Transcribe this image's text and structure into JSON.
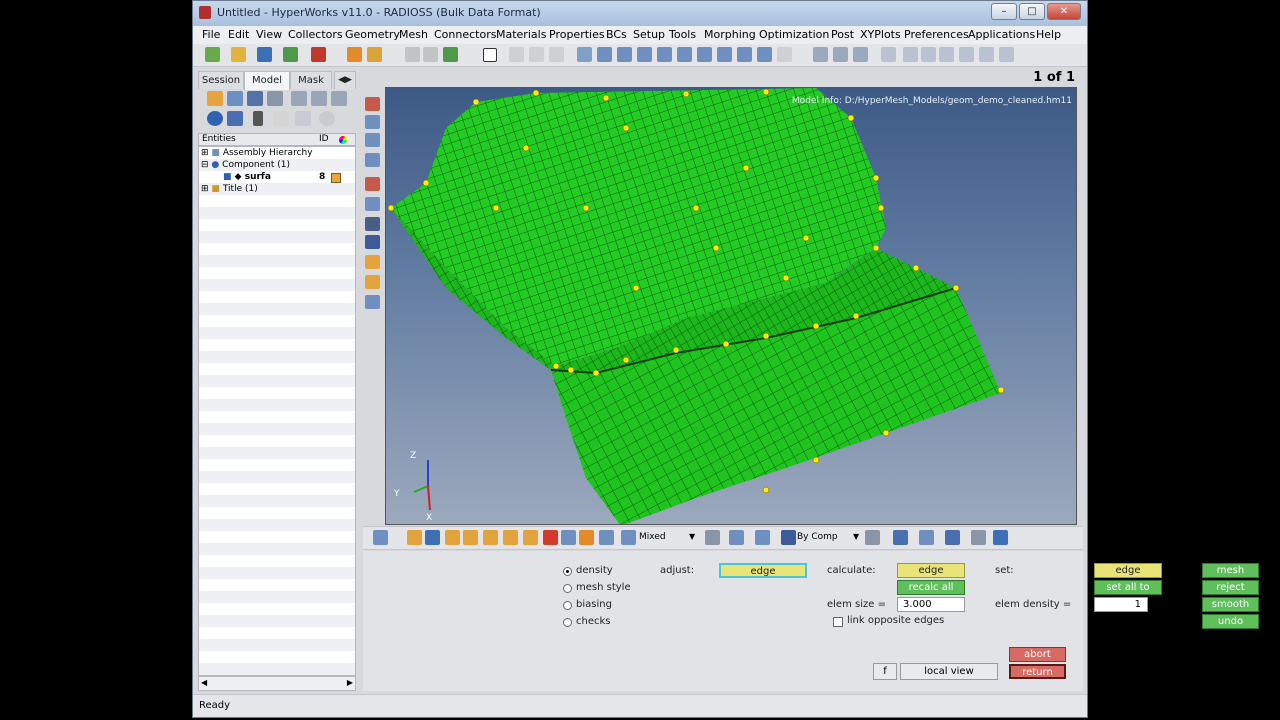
{
  "window": {
    "title": "Untitled - HyperWorks v11.0 - RADIOSS (Bulk Data Format)"
  },
  "menu": [
    "File",
    "Edit",
    "View",
    "Collectors",
    "Geometry",
    "Mesh",
    "Connectors",
    "Materials",
    "Properties",
    "BCs",
    "Setup",
    "Tools",
    "Morphing",
    "Optimization",
    "Post",
    "XYPlots",
    "Preferences",
    "Applications",
    "Help"
  ],
  "browser": {
    "tabs": [
      "Session",
      "Model",
      "Mask"
    ],
    "header": {
      "entities": "Entities",
      "id": "ID"
    },
    "tree": [
      {
        "label": "Assembly Hierarchy"
      },
      {
        "label": "Component (1)"
      },
      {
        "label": "surfa",
        "id": "8"
      },
      {
        "label": "Title (1)"
      }
    ]
  },
  "viewport": {
    "page_indicator": "1 of 1",
    "model_info": "Model Info: D:/HyperMesh_Models/geom_demo_cleaned.hm11",
    "axis": {
      "x": "X",
      "y": "Y",
      "z": "Z"
    }
  },
  "vis_toolbar": {
    "mode": "Mixed",
    "color_by": "By Comp"
  },
  "panel": {
    "radios": [
      "density",
      "mesh style",
      "biasing",
      "checks"
    ],
    "adjust": {
      "label": "adjust:",
      "button": "edge"
    },
    "calculate": {
      "label": "calculate:",
      "edge": "edge",
      "recalc": "recalc all"
    },
    "elem_size": {
      "label": "elem size =",
      "value": "3.000"
    },
    "link": "link opposite edges",
    "set": {
      "label": "set:",
      "edge": "edge",
      "set_all": "set all to"
    },
    "elem_density": {
      "label": "elem density =",
      "value": "1"
    },
    "actions": [
      "mesh",
      "reject",
      "smooth",
      "undo"
    ],
    "abort": "abort",
    "return": "return",
    "f_button": "f",
    "local_view": "local view"
  },
  "status": "Ready",
  "colors": {
    "mesh": "#22cc22",
    "mesh_line": "#0b3d0b",
    "node": "#ffee00",
    "accent_green": "#5fbf5a",
    "accent_yellow": "#e8e478",
    "accent_red": "#d76a63"
  }
}
